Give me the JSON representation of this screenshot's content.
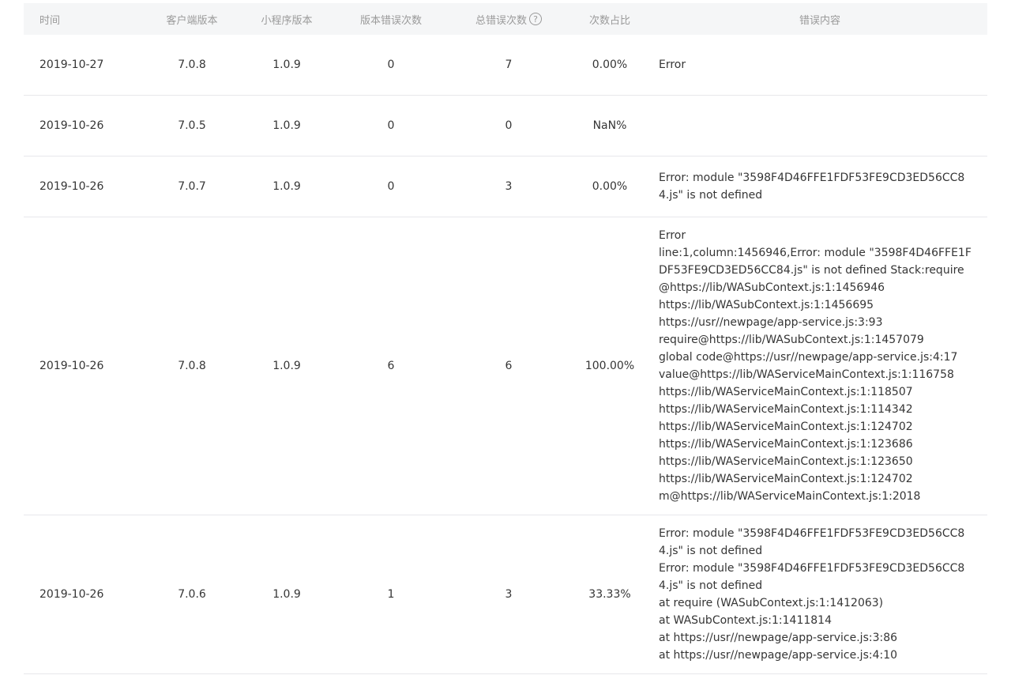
{
  "headers": {
    "time": "时间",
    "client_version": "客户端版本",
    "mini_version": "小程序版本",
    "version_errors": "版本错误次数",
    "total_errors": "总错误次数",
    "ratio": "次数占比",
    "content": "错误内容"
  },
  "help_icon_glyph": "?",
  "rows": [
    {
      "time": "2019-10-27",
      "client_version": "7.0.8",
      "mini_version": "1.0.9",
      "version_errors": "0",
      "total_errors": "7",
      "ratio": "0.00%",
      "content": [
        "Error"
      ]
    },
    {
      "time": "2019-10-26",
      "client_version": "7.0.5",
      "mini_version": "1.0.9",
      "version_errors": "0",
      "total_errors": "0",
      "ratio": "NaN%",
      "content": []
    },
    {
      "time": "2019-10-26",
      "client_version": "7.0.7",
      "mini_version": "1.0.9",
      "version_errors": "0",
      "total_errors": "3",
      "ratio": "0.00%",
      "content": [
        "Error: module \"3598F4D46FFE1FDF53FE9CD3ED56CC84.js\" is not defined"
      ]
    },
    {
      "time": "2019-10-26",
      "client_version": "7.0.8",
      "mini_version": "1.0.9",
      "version_errors": "6",
      "total_errors": "6",
      "ratio": "100.00%",
      "content": [
        "Error",
        "line:1,column:1456946,Error: module \"3598F4D46FFE1FDF53FE9CD3ED56CC84.js\" is not defined Stack:require@https://lib/WASubContext.js:1:1456946",
        "https://lib/WASubContext.js:1:1456695",
        "https://usr//newpage/app-service.js:3:93",
        "require@https://lib/WASubContext.js:1:1457079",
        "global code@https://usr//newpage/app-service.js:4:17",
        "value@https://lib/WAServiceMainContext.js:1:116758",
        "https://lib/WAServiceMainContext.js:1:118507",
        "https://lib/WAServiceMainContext.js:1:114342",
        "https://lib/WAServiceMainContext.js:1:124702",
        "https://lib/WAServiceMainContext.js:1:123686",
        "https://lib/WAServiceMainContext.js:1:123650",
        "https://lib/WAServiceMainContext.js:1:124702",
        "m@https://lib/WAServiceMainContext.js:1:2018"
      ]
    },
    {
      "time": "2019-10-26",
      "client_version": "7.0.6",
      "mini_version": "1.0.9",
      "version_errors": "1",
      "total_errors": "3",
      "ratio": "33.33%",
      "content": [
        "Error: module \"3598F4D46FFE1FDF53FE9CD3ED56CC84.js\" is not defined",
        "Error: module \"3598F4D46FFE1FDF53FE9CD3ED56CC84.js\" is not defined",
        "at require (WASubContext.js:1:1412063)",
        "at WASubContext.js:1:1411814",
        "at https://usr//newpage/app-service.js:3:86",
        "at https://usr//newpage/app-service.js:4:10"
      ]
    }
  ]
}
